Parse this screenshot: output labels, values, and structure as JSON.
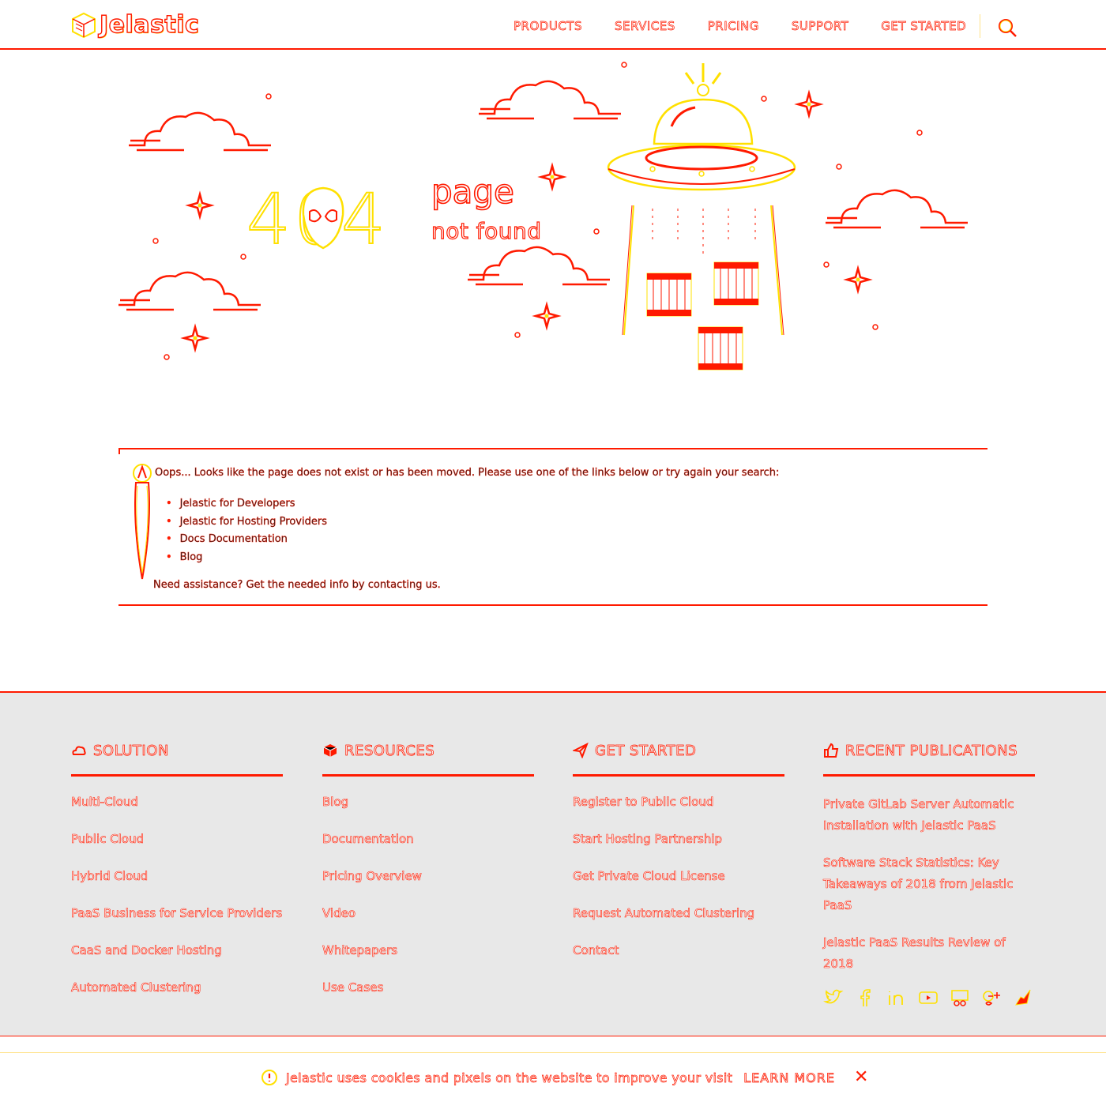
{
  "brand": {
    "name": "Jelastic"
  },
  "nav": {
    "items": [
      "PRODUCTS",
      "SERVICES",
      "PRICING",
      "SUPPORT",
      "GET STARTED"
    ]
  },
  "hero": {
    "code": "404",
    "title": "page",
    "subtitle": "not found"
  },
  "message": {
    "intro": "Oops... Looks like the page does not exist or has been moved. Please use one of the links below or try again your search:",
    "links": [
      "Jelastic for Developers",
      "Jelastic for Hosting Providers",
      "Docs Documentation",
      "Blog"
    ],
    "outro": "Need assistance? Get the needed info by contacting us."
  },
  "footer": {
    "columns": [
      {
        "icon": "cloud-icon",
        "title": "SOLUTION",
        "items": [
          "Multi-Cloud",
          "Public Cloud",
          "Hybrid Cloud",
          "PaaS Business for Service Providers",
          "CaaS and Docker Hosting",
          "Automated Clustering"
        ]
      },
      {
        "icon": "cube-icon",
        "title": "RESOURCES",
        "items": [
          "Blog",
          "Documentation",
          "Pricing Overview",
          "Video",
          "Whitepapers",
          "Use Cases"
        ]
      },
      {
        "icon": "paper-plane-icon",
        "title": "GET STARTED",
        "items": [
          "Register to Public Cloud",
          "Start Hosting Partnership",
          "Get Private Cloud License",
          "Request Automated Clustering",
          "Contact"
        ]
      },
      {
        "icon": "thumbs-up-icon",
        "title": "RECENT PUBLICATIONS",
        "items": [
          "Private GitLab Server Automatic Installation with Jelastic PaaS",
          "Software Stack Statistics: Key Takeaways of 2018 from Jelastic PaaS",
          "Jelastic PaaS Results Review of 2018"
        ]
      }
    ],
    "socials": [
      "twitter-icon",
      "facebook-icon",
      "linkedin-icon",
      "youtube-icon",
      "slideshare-icon",
      "google-plus-icon",
      "telegram-icon"
    ]
  },
  "cookie": {
    "text": "Jelastic uses cookies and pixels on the website to improve your visit",
    "learn_more": "LEARN MORE",
    "close": "✕"
  },
  "colors": {
    "accent": "#ff1a00",
    "highlight": "#ffe000",
    "footer_bg": "#e8e8e8"
  }
}
